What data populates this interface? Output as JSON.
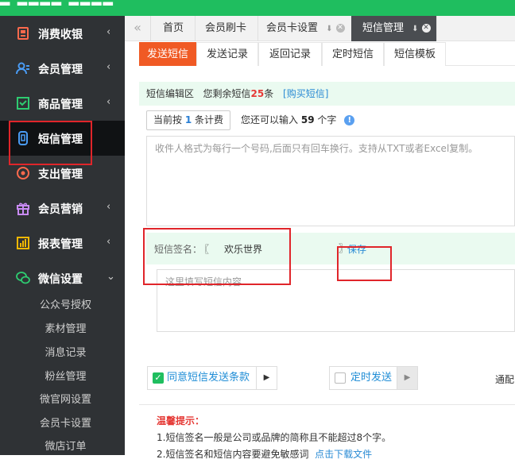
{
  "colors": {
    "brand": "#1fbe5f",
    "sidebar": "#2f3235",
    "accent": "#f05a24",
    "highlight": "#e0252a",
    "link": "#2a8bd4"
  },
  "sidebar": {
    "items": [
      {
        "label": "消费收银",
        "icon": "cashier-icon"
      },
      {
        "label": "会员管理",
        "icon": "members-icon"
      },
      {
        "label": "商品管理",
        "icon": "goods-icon"
      },
      {
        "label": "短信管理",
        "icon": "sms-icon"
      },
      {
        "label": "支出管理",
        "icon": "expense-icon"
      },
      {
        "label": "会员营销",
        "icon": "gift-icon"
      },
      {
        "label": "报表管理",
        "icon": "report-icon"
      },
      {
        "label": "微信设置",
        "icon": "wechat-icon"
      }
    ],
    "chevron_left": "‹",
    "chevron_down": "⌄",
    "wechat_sub": [
      "公众号授权",
      "素材管理",
      "消息记录",
      "粉丝管理",
      "微官网设置",
      "会员卡设置",
      "微店订单"
    ]
  },
  "tabs": {
    "back": "«",
    "items": [
      {
        "label": "首页"
      },
      {
        "label": "会员刷卡"
      },
      {
        "label": "会员卡设置"
      },
      {
        "label": "短信管理"
      }
    ]
  },
  "subtabs": [
    "发送短信",
    "发送记录",
    "返回记录",
    "定时短信",
    "短信模板"
  ],
  "editor": {
    "title": "短信编辑区",
    "remaining_prefix": "您剩余短信",
    "remaining_count": "25",
    "remaining_suffix": "条",
    "buy_link": "[购买短信]"
  },
  "billing": {
    "btn_prefix": "当前按",
    "btn_count": "1",
    "btn_suffix": "条计费",
    "info_prefix": "您还可以输入",
    "info_count": "59",
    "info_suffix": "个字"
  },
  "recipients_placeholder": "收件人格式为每行一个号码,后面只有回车换行。支持从TXT或者Excel复制。",
  "signature": {
    "label": "短信签名：",
    "open": "〖",
    "value": "欢乐世界",
    "close": "〗",
    "save": "保存"
  },
  "message_placeholder": "这里填写短信内容...",
  "agree_label": "同意短信发送条款",
  "timed_label": "定时发送",
  "channel_label": "通配",
  "tips": {
    "title": "温馨提示：",
    "line1": "1.短信签名一般是公司或品牌的简称且不能超过8个字。",
    "line2_prefix": "2.短信签名和短信内容要避免敏感词",
    "line2_link": "点击下载文件"
  }
}
